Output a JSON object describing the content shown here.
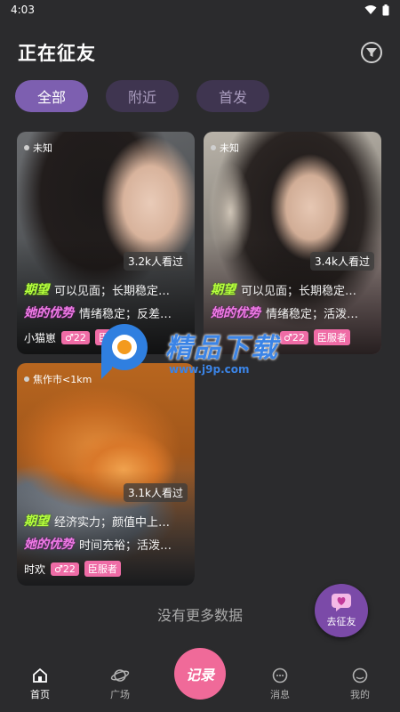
{
  "status": {
    "time": "4:03"
  },
  "header": {
    "title": "正在征友",
    "filter_icon": "filter-icon"
  },
  "tabs": [
    {
      "label": "全部",
      "active": true
    },
    {
      "label": "附近",
      "active": false
    },
    {
      "label": "首发",
      "active": false
    }
  ],
  "cards": [
    {
      "location": "未知",
      "views": "3.2k人看过",
      "hope_tag": "期望",
      "hope": "可以见面；长期稳定…",
      "adv_tag": "她的优势",
      "adv": "情绪稳定；反差…",
      "name": "小猫崽",
      "age": "22",
      "role": "臣服者"
    },
    {
      "location": "未知",
      "views": "3.4k人看过",
      "hope_tag": "期望",
      "hope": "可以见面；长期稳定…",
      "adv_tag": "她的优势",
      "adv": "情绪稳定；活泼…",
      "name": "",
      "age": "22",
      "role": "臣服者"
    },
    {
      "location": "焦作市<1km",
      "views": "3.1k人看过",
      "hope_tag": "期望",
      "hope": "经济实力；颜值中上…",
      "adv_tag": "她的优势",
      "adv": "时间充裕；活泼…",
      "name": "时欢",
      "age": "22",
      "role": "臣服者"
    }
  ],
  "watermark": {
    "title": "精品下载",
    "url": "www.j9p.com"
  },
  "list_footer": "没有更多数据",
  "fab": {
    "label": "去征友"
  },
  "record_button": "记录",
  "nav": [
    {
      "label": "首页",
      "icon": "home-icon",
      "active": true
    },
    {
      "label": "广场",
      "icon": "planet-icon",
      "active": false
    },
    {
      "label": "消息",
      "icon": "message-icon",
      "active": false
    },
    {
      "label": "我的",
      "icon": "profile-icon",
      "active": false
    }
  ],
  "colors": {
    "accent": "#7d5fb0",
    "pink": "#ef6ca6",
    "hope_green": "#b6ff3e",
    "adv_pink": "#f07be6"
  }
}
